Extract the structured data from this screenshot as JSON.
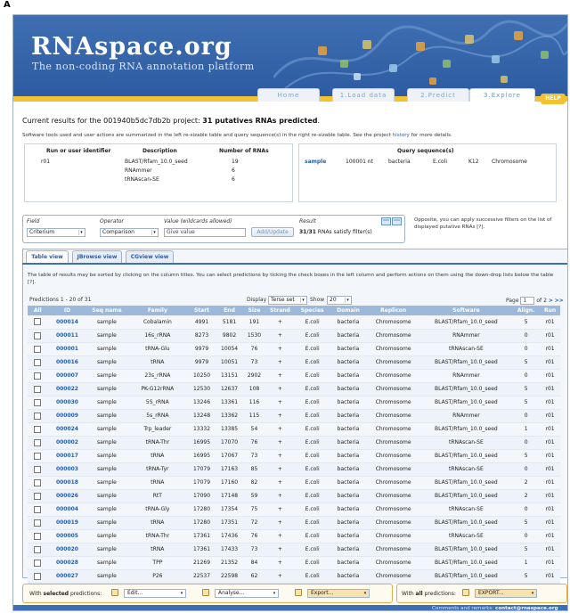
{
  "figure_letter": "A",
  "banner": {
    "title": "RNAspace.org",
    "subtitle": "The non-coding RNA annotation platform"
  },
  "nav": {
    "tabs": [
      {
        "label": "Home"
      },
      {
        "label": "1.Load data"
      },
      {
        "label": "2.Predict"
      },
      {
        "label": "3.Explore"
      }
    ],
    "active": "3.Explore",
    "help": "HELP"
  },
  "results": {
    "prefix": "Current results for the 001940b5dc7db2b project: ",
    "count_text": "31 putatives RNAs predicted",
    "suffix": ".",
    "desc_prefix": "Software tools used and user actions are summarized in the left re-sizable table and query sequence(s) in the right re-sizable table. See the project ",
    "desc_link": "history",
    "desc_suffix": " for more details."
  },
  "tools_table": {
    "headers": [
      "Run or user identifier",
      "Description",
      "Number of RNAs"
    ],
    "rows": [
      [
        "r01",
        "BLAST/Rfam_10.0_seed",
        "19"
      ],
      [
        "",
        "RNAmmer",
        "6"
      ],
      [
        "",
        "tRNAscan-SE",
        "6"
      ]
    ]
  },
  "query_table": {
    "header": "Query sequence(s)",
    "row": [
      "sample",
      "100001 nt",
      "bacteria",
      "E.coli",
      "K12",
      "Chromosome"
    ]
  },
  "filter": {
    "field_label": "Field",
    "operator_label": "Operator",
    "value_label": "Value (wildcards allowed)",
    "result_label": "Result",
    "field_value": "Criterium",
    "operator_value": "Comparison",
    "value_placeholder": "Give value",
    "add_button": "Add/Update",
    "result_count": "31/31",
    "result_text": " RNAs satisfy filter(s)",
    "opposite_text": "Opposite, you can apply successive filters on the list of displayed putative RNAs [?]."
  },
  "views": {
    "tabs": [
      "Table view",
      "JBrowse view",
      "CGview view"
    ],
    "active": "Table view",
    "description": "The table of results may be sorted by clicking on the column titles. You can select predictions by ticking the check boxes in the left column and  perform actions on them using the down-drop lists below the table [?]."
  },
  "table_controls": {
    "range": "Predictions 1 - 20 of 31",
    "display_label": "Display",
    "display_value": "Terse set",
    "show_label": "Show",
    "show_value": "20",
    "page_label": "Page",
    "page_value": "1",
    "page_of": "of 2",
    "next": ">",
    "last": ">>"
  },
  "predictions": {
    "columns": [
      "All",
      "ID",
      "Seq name",
      "Family",
      "Start",
      "End",
      "Size",
      "Strand",
      "Species",
      "Domain",
      "Replicon",
      "Software",
      "Align.",
      "Run"
    ],
    "rows": [
      [
        "000014",
        "sample",
        "Cobalamin",
        "4991",
        "5181",
        "191",
        "+",
        "E.coli",
        "bacteria",
        "Chromosome",
        "BLAST/Rfam_10.0_seed",
        "5",
        "r01"
      ],
      [
        "000011",
        "sample",
        "16s_rRNA",
        "8273",
        "9802",
        "1530",
        "+",
        "E.coli",
        "bacteria",
        "Chromosome",
        "RNAmmer",
        "0",
        "r01"
      ],
      [
        "000001",
        "sample",
        "tRNA-Glu",
        "9979",
        "10054",
        "76",
        "+",
        "E.coli",
        "bacteria",
        "Chromosome",
        "tRNAscan-SE",
        "0",
        "r01"
      ],
      [
        "000016",
        "sample",
        "tRNA",
        "9979",
        "10051",
        "73",
        "+",
        "E.coli",
        "bacteria",
        "Chromosome",
        "BLAST/Rfam_10.0_seed",
        "5",
        "r01"
      ],
      [
        "000007",
        "sample",
        "23s_rRNA",
        "10250",
        "13151",
        "2902",
        "+",
        "E.coli",
        "bacteria",
        "Chromosome",
        "RNAmmer",
        "0",
        "r01"
      ],
      [
        "000022",
        "sample",
        "PK-G12rRNA",
        "12530",
        "12637",
        "108",
        "+",
        "E.coli",
        "bacteria",
        "Chromosome",
        "BLAST/Rfam_10.0_seed",
        "5",
        "r01"
      ],
      [
        "000030",
        "sample",
        "5S_rRNA",
        "13246",
        "13361",
        "116",
        "+",
        "E.coli",
        "bacteria",
        "Chromosome",
        "BLAST/Rfam_10.0_seed",
        "5",
        "r01"
      ],
      [
        "000009",
        "sample",
        "5s_rRNA",
        "13248",
        "13362",
        "115",
        "+",
        "E.coli",
        "bacteria",
        "Chromosome",
        "RNAmmer",
        "0",
        "r01"
      ],
      [
        "000024",
        "sample",
        "Trp_leader",
        "13332",
        "13385",
        "54",
        "+",
        "E.coli",
        "bacteria",
        "Chromosome",
        "BLAST/Rfam_10.0_seed",
        "1",
        "r01"
      ],
      [
        "000002",
        "sample",
        "tRNA-Thr",
        "16995",
        "17070",
        "76",
        "+",
        "E.coli",
        "bacteria",
        "Chromosome",
        "tRNAscan-SE",
        "0",
        "r01"
      ],
      [
        "000017",
        "sample",
        "tRNA",
        "16995",
        "17067",
        "73",
        "+",
        "E.coli",
        "bacteria",
        "Chromosome",
        "BLAST/Rfam_10.0_seed",
        "5",
        "r01"
      ],
      [
        "000003",
        "sample",
        "tRNA-Tyr",
        "17079",
        "17163",
        "85",
        "+",
        "E.coli",
        "bacteria",
        "Chromosome",
        "tRNAscan-SE",
        "0",
        "r01"
      ],
      [
        "000018",
        "sample",
        "tRNA",
        "17079",
        "17160",
        "82",
        "+",
        "E.coli",
        "bacteria",
        "Chromosome",
        "BLAST/Rfam_10.0_seed",
        "2",
        "r01"
      ],
      [
        "000026",
        "sample",
        "RtT",
        "17090",
        "17148",
        "59",
        "+",
        "E.coli",
        "bacteria",
        "Chromosome",
        "BLAST/Rfam_10.0_seed",
        "2",
        "r01"
      ],
      [
        "000004",
        "sample",
        "tRNA-Gly",
        "17280",
        "17354",
        "75",
        "+",
        "E.coli",
        "bacteria",
        "Chromosome",
        "tRNAscan-SE",
        "0",
        "r01"
      ],
      [
        "000019",
        "sample",
        "tRNA",
        "17280",
        "17351",
        "72",
        "+",
        "E.coli",
        "bacteria",
        "Chromosome",
        "BLAST/Rfam_10.0_seed",
        "5",
        "r01"
      ],
      [
        "000005",
        "sample",
        "tRNA-Thr",
        "17361",
        "17436",
        "76",
        "+",
        "E.coli",
        "bacteria",
        "Chromosome",
        "tRNAscan-SE",
        "0",
        "r01"
      ],
      [
        "000020",
        "sample",
        "tRNA",
        "17361",
        "17433",
        "73",
        "+",
        "E.coli",
        "bacteria",
        "Chromosome",
        "BLAST/Rfam_10.0_seed",
        "5",
        "r01"
      ],
      [
        "000028",
        "sample",
        "TPP",
        "21269",
        "21352",
        "84",
        "+",
        "E.coli",
        "bacteria",
        "Chromosome",
        "BLAST/Rfam_10.0_seed",
        "1",
        "r01"
      ],
      [
        "000027",
        "sample",
        "P26",
        "22537",
        "22598",
        "62",
        "+",
        "E.coli",
        "bacteria",
        "Chromosome",
        "BLAST/Rfam_10.0_seed",
        "5",
        "r01"
      ]
    ]
  },
  "actions": {
    "with_prefix": "With ",
    "selected_word": "selected",
    "selected_suffix": " predictions:",
    "edit": "Edit...",
    "analyse": "Analyse...",
    "export": "Export...",
    "all_word": "all",
    "all_suffix": " predictions:",
    "export_all": "EXPORT..."
  },
  "footer": {
    "prefix": "Comments and remarks: ",
    "email": "contact@rnaspace.org"
  },
  "colors": {
    "banner": "#3f6fb3",
    "accent": "#f2c232",
    "link": "#2a5cab",
    "header": "#9cb9dc"
  },
  "icons": [
    "filter-icons",
    "edit-icon",
    "analyse-icon",
    "export-icon",
    "export-all-icon"
  ]
}
